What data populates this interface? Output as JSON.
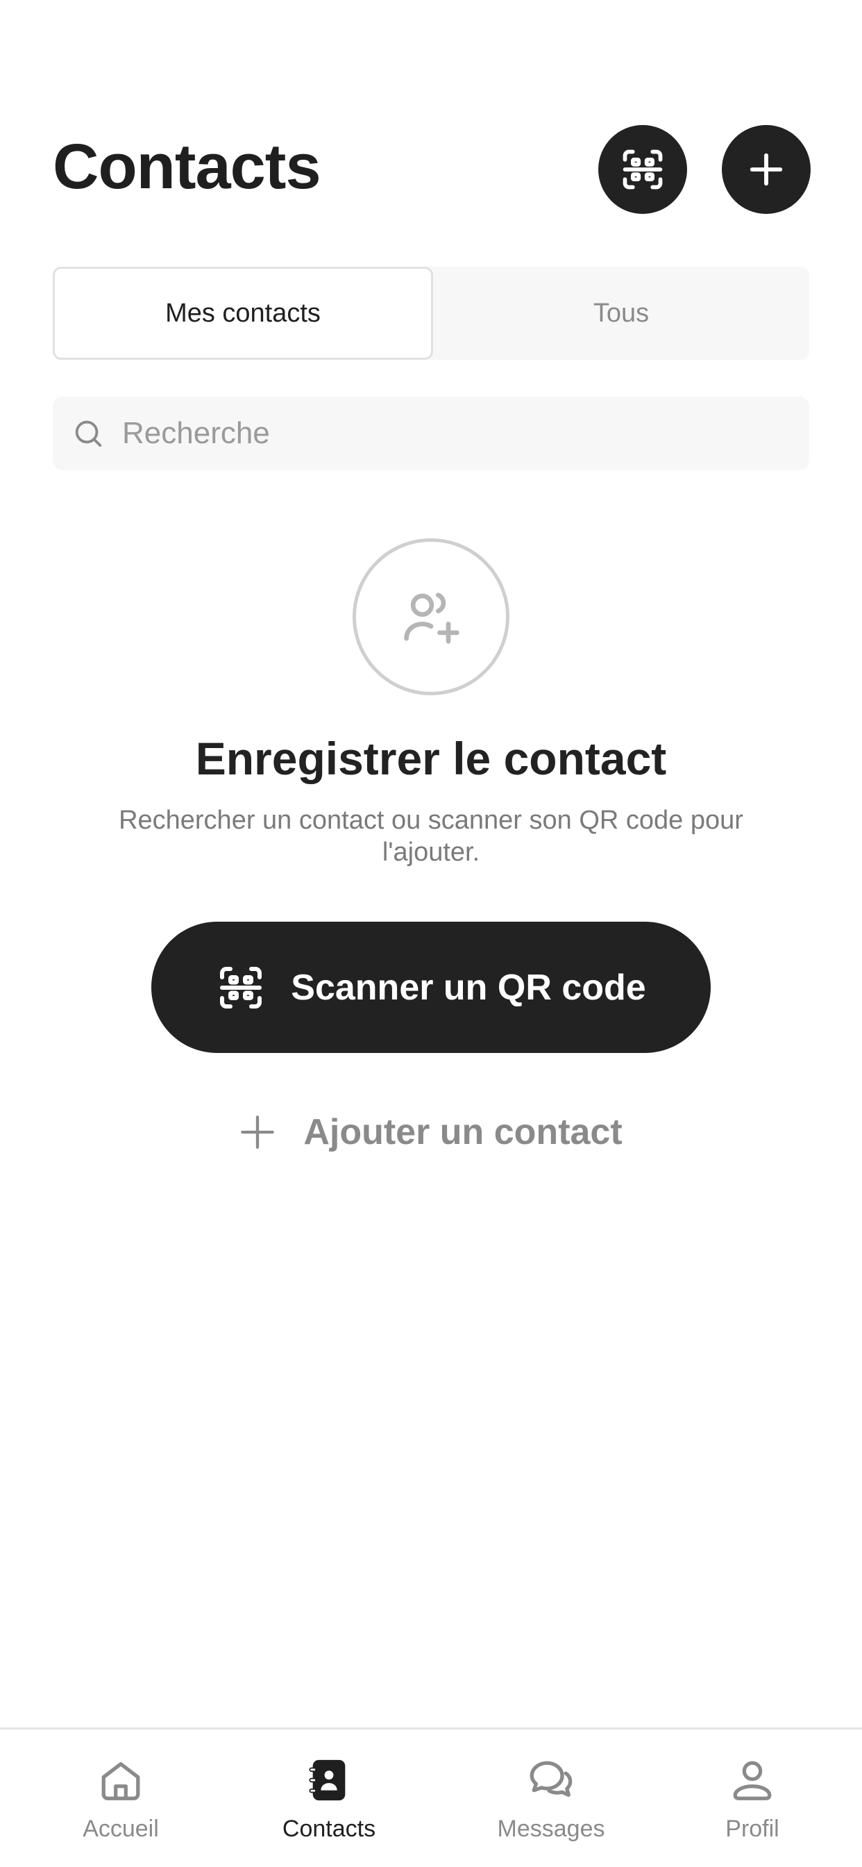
{
  "header": {
    "title": "Contacts",
    "scan_icon": "qr-scan-icon",
    "add_icon": "plus-icon"
  },
  "tabs": [
    {
      "label": "Mes contacts",
      "active": true
    },
    {
      "label": "Tous",
      "active": false
    }
  ],
  "search": {
    "placeholder": "Recherche",
    "value": "",
    "icon": "search-icon"
  },
  "empty_state": {
    "icon": "user-add-icon",
    "title": "Enregistrer le contact",
    "description": "Rechercher un contact ou scanner son QR code pour l'ajouter.",
    "primary_button": "Scanner un QR code",
    "secondary_link": "Ajouter un contact"
  },
  "bottom_nav": [
    {
      "label": "Accueil",
      "icon": "home-icon",
      "active": false
    },
    {
      "label": "Contacts",
      "icon": "contacts-book-icon",
      "active": true
    },
    {
      "label": "Messages",
      "icon": "chat-bubbles-icon",
      "active": false
    },
    {
      "label": "Profil",
      "icon": "user-icon",
      "active": false
    }
  ],
  "colors": {
    "primary": "#222222",
    "muted_text": "#8a8a8a",
    "surface": "#f7f7f7",
    "background": "#ffffff"
  }
}
